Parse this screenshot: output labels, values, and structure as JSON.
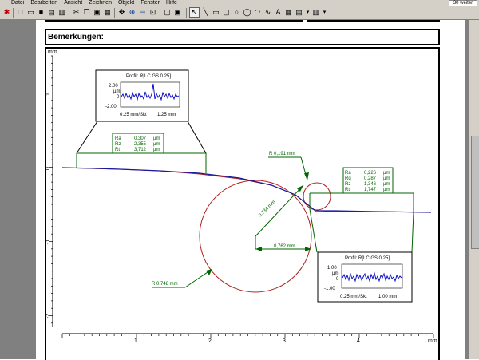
{
  "menu": [
    "Datei",
    "Bearbeiten",
    "Ansicht",
    "Zeichnen",
    "Objekt",
    "Fenster",
    "Hilfe"
  ],
  "window_chip": "30 weiter",
  "toolbar_icons": [
    "pin-icon",
    "new-file-icon",
    "open-file-icon",
    "save-icon",
    "print-icon",
    "print-preview-icon",
    "cut-icon",
    "copy-icon",
    "paste-icon",
    "clipboard-icon",
    "pan-icon",
    "zoom-in-icon",
    "zoom-out-icon",
    "zoom-fit-icon",
    "page-icon",
    "select-arrow-icon",
    "line-tool-icon",
    "rectangle-tool-icon",
    "ellipse-tool-icon",
    "circle-tool-icon",
    "arc-tool-icon",
    "curve-tool-icon",
    "text-tool-icon",
    "image-tool-icon",
    "table-tool-icon",
    "chart-tool-icon"
  ],
  "remarks_label": "Bemerkungen:",
  "axes": {
    "y_unit": "mm",
    "x_unit": "mm",
    "y_ticks": [
      "1",
      "0",
      "-1",
      "-2"
    ],
    "x_ticks": [
      "1",
      "2",
      "3",
      "4"
    ]
  },
  "profile_box_left": {
    "title": "Profil: R[LC GS 0.25]",
    "y_labels": [
      "2.00",
      "µm",
      "0",
      "-2.00"
    ],
    "scale": "0.25 mm/Skt",
    "length": "1.25 mm"
  },
  "profile_box_right": {
    "title": "Profil: R[LC GS 0.25]",
    "y_labels": [
      "1.00",
      "µm",
      "0",
      "-1.00"
    ],
    "scale": "0.25 mm/Skt",
    "length": "1.00 mm"
  },
  "params_left": [
    {
      "name": "Ra",
      "value": "0,307",
      "unit": "µm"
    },
    {
      "name": "Rz",
      "value": "2,355",
      "unit": "µm"
    },
    {
      "name": "Rt",
      "value": "3,712",
      "unit": "µm"
    }
  ],
  "params_right": [
    {
      "name": "Ra",
      "value": "0,226",
      "unit": "µm"
    },
    {
      "name": "Rq",
      "value": "0,287",
      "unit": "µm"
    },
    {
      "name": "Rz",
      "value": "1,346",
      "unit": "µm"
    },
    {
      "name": "Rt",
      "value": "1,747",
      "unit": "µm"
    }
  ],
  "annotations": {
    "small_radius": "R  0,191 mm",
    "large_radius": "R  0,748 mm",
    "diagonal": "0,734 mm",
    "horizontal": "0,762 mm"
  },
  "colors": {
    "annotation_green": "#006400",
    "profile_blue": "#1a1aa0",
    "fit_red": "#b02020"
  }
}
